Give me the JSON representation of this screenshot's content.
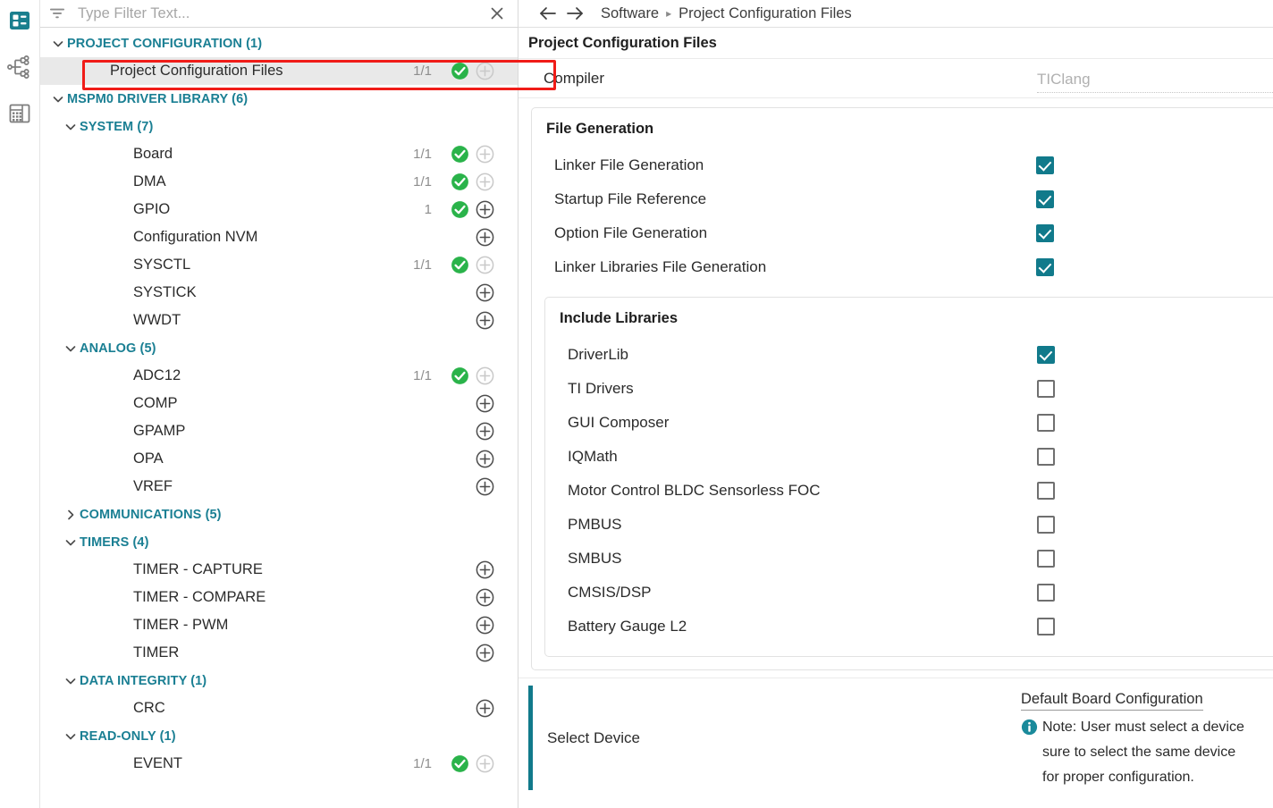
{
  "rail": {
    "items": [
      {
        "name": "structure-view-icon",
        "label": "Structure View",
        "selected": true
      },
      {
        "name": "node-graph-icon",
        "label": "Node Graph View",
        "selected": false
      },
      {
        "name": "register-table-icon",
        "label": "Register View",
        "selected": false
      }
    ]
  },
  "filter": {
    "placeholder": "Type Filter Text...",
    "value": "",
    "filter_icon": "filter-icon",
    "close_icon": "close-icon"
  },
  "tree": {
    "groups": [
      {
        "label": "PROJECT CONFIGURATION (1)",
        "expanded": true,
        "level": 1,
        "rows": [
          {
            "label": "Project Configuration Files",
            "count": "1/1",
            "ok": true,
            "plus": "disabled",
            "selected": true,
            "highlighted": true
          }
        ]
      },
      {
        "label": "MSPM0 DRIVER LIBRARY (6)",
        "expanded": true,
        "level": 1,
        "rows": [],
        "subgroups": [
          {
            "label": "SYSTEM (7)",
            "expanded": true,
            "rows": [
              {
                "label": "Board",
                "count": "1/1",
                "ok": true,
                "plus": "disabled"
              },
              {
                "label": "DMA",
                "count": "1/1",
                "ok": true,
                "plus": "disabled"
              },
              {
                "label": "GPIO",
                "count": "1",
                "ok": true,
                "plus": "enabled"
              },
              {
                "label": "Configuration NVM",
                "count": "",
                "ok": false,
                "plus": "enabled"
              },
              {
                "label": "SYSCTL",
                "count": "1/1",
                "ok": true,
                "plus": "disabled"
              },
              {
                "label": "SYSTICK",
                "count": "",
                "ok": false,
                "plus": "enabled"
              },
              {
                "label": "WWDT",
                "count": "",
                "ok": false,
                "plus": "enabled"
              }
            ]
          },
          {
            "label": "ANALOG (5)",
            "expanded": true,
            "rows": [
              {
                "label": "ADC12",
                "count": "1/1",
                "ok": true,
                "plus": "disabled"
              },
              {
                "label": "COMP",
                "count": "",
                "ok": false,
                "plus": "enabled"
              },
              {
                "label": "GPAMP",
                "count": "",
                "ok": false,
                "plus": "enabled"
              },
              {
                "label": "OPA",
                "count": "",
                "ok": false,
                "plus": "enabled"
              },
              {
                "label": "VREF",
                "count": "",
                "ok": false,
                "plus": "enabled"
              }
            ]
          },
          {
            "label": "COMMUNICATIONS (5)",
            "expanded": false,
            "rows": []
          },
          {
            "label": "TIMERS (4)",
            "expanded": true,
            "rows": [
              {
                "label": "TIMER - CAPTURE",
                "count": "",
                "ok": false,
                "plus": "enabled"
              },
              {
                "label": "TIMER - COMPARE",
                "count": "",
                "ok": false,
                "plus": "enabled"
              },
              {
                "label": "TIMER - PWM",
                "count": "",
                "ok": false,
                "plus": "enabled"
              },
              {
                "label": "TIMER",
                "count": "",
                "ok": false,
                "plus": "enabled"
              }
            ]
          },
          {
            "label": "DATA INTEGRITY (1)",
            "expanded": true,
            "rows": [
              {
                "label": "CRC",
                "count": "",
                "ok": false,
                "plus": "enabled"
              }
            ]
          },
          {
            "label": "READ-ONLY (1)",
            "expanded": true,
            "rows": [
              {
                "label": "EVENT",
                "count": "1/1",
                "ok": true,
                "plus": "disabled"
              }
            ]
          }
        ]
      }
    ]
  },
  "breadcrumb": {
    "back_icon": "arrow-left-icon",
    "forward_icon": "arrow-right-icon",
    "items": [
      "Software",
      "Project Configuration Files"
    ],
    "separator": "▸"
  },
  "main": {
    "page_title": "Project Configuration Files",
    "compiler": {
      "label": "Compiler",
      "value": "TIClang"
    },
    "file_generation": {
      "title": "File Generation",
      "options": [
        {
          "label": "Linker File Generation",
          "checked": true
        },
        {
          "label": "Startup File Reference",
          "checked": true
        },
        {
          "label": "Option File Generation",
          "checked": true
        },
        {
          "label": "Linker Libraries File Generation",
          "checked": true
        }
      ],
      "include_libraries": {
        "title": "Include Libraries",
        "options": [
          {
            "label": "DriverLib",
            "checked": true
          },
          {
            "label": "TI Drivers",
            "checked": false
          },
          {
            "label": "GUI Composer",
            "checked": false
          },
          {
            "label": "IQMath",
            "checked": false
          },
          {
            "label": "Motor Control BLDC Sensorless FOC",
            "checked": false
          },
          {
            "label": "PMBUS",
            "checked": false
          },
          {
            "label": "SMBUS",
            "checked": false
          },
          {
            "label": "CMSIS/DSP",
            "checked": false
          },
          {
            "label": "Battery Gauge L2",
            "checked": false
          }
        ]
      }
    },
    "select_device": {
      "label": "Select Device",
      "tooltip_title": "Default Board Configuration",
      "note_icon": "info-icon",
      "note_text": "Note: User must select a device\nsure to select the same device\nfor proper configuration."
    }
  },
  "colors": {
    "accent_teal": "#117a8b",
    "group_header_teal": "#1a7f93",
    "ok_green": "#2ab34a",
    "annotation_red": "#f01c18",
    "selected_row_bg": "#e9e9e9"
  }
}
